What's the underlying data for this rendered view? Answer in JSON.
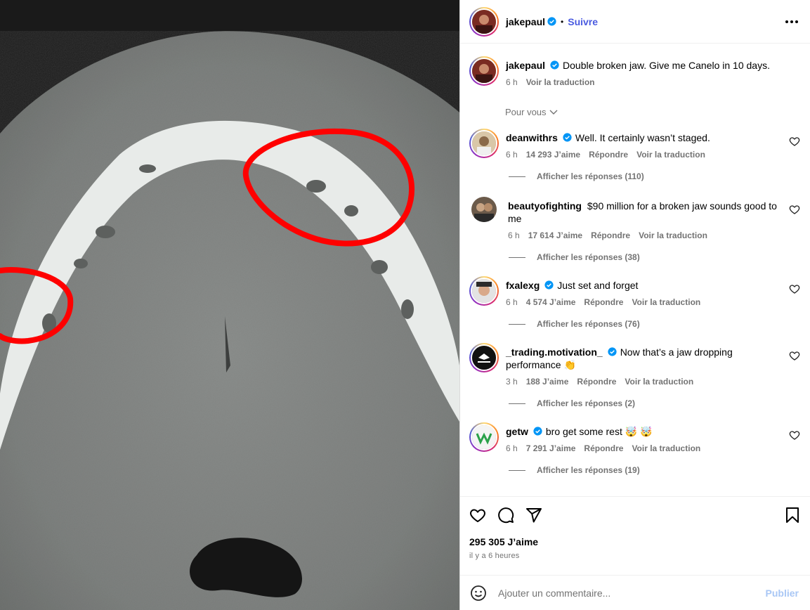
{
  "post": {
    "author": "jakepaul",
    "follow_label": "Suivre",
    "caption": "Double broken jaw. Give me Canelo in 10 days.",
    "caption_time": "6 h",
    "caption_translate": "Voir la traduction",
    "sort_label": "Pour vous"
  },
  "comments": [
    {
      "user": "deanwithrs",
      "verified": true,
      "text": "Well. It certainly wasn’t staged.",
      "time": "6 h",
      "likes": "14 293 J’aime",
      "reply": "Répondre",
      "translate": "Voir la traduction",
      "replies": "Afficher les réponses (110)"
    },
    {
      "user": "beautyofighting",
      "verified": false,
      "text": "$90 million for a broken jaw sounds good to me",
      "time": "6 h",
      "likes": "17 614 J’aime",
      "reply": "Répondre",
      "translate": "Voir la traduction",
      "replies": "Afficher les réponses (38)"
    },
    {
      "user": "fxalexg",
      "verified": true,
      "text": "Just set and forget",
      "time": "6 h",
      "likes": "4 574 J’aime",
      "reply": "Répondre",
      "translate": "Voir la traduction",
      "replies": "Afficher les réponses (76)"
    },
    {
      "user": "_trading.motivation_",
      "verified": true,
      "text": "Now that’s a jaw dropping performance 👏",
      "time": "3 h",
      "likes": "188 J’aime",
      "reply": "Répondre",
      "translate": "Voir la traduction",
      "replies": "Afficher les réponses (2)"
    },
    {
      "user": "getw",
      "verified": true,
      "text": "bro get some rest 🤯 🤯",
      "time": "6 h",
      "likes": "7 291 J’aime",
      "reply": "Répondre",
      "translate": "Voir la traduction",
      "replies": "Afficher les réponses (19)"
    }
  ],
  "footer": {
    "likes": "295 305 J’aime",
    "time": "il y a 6 heures",
    "comment_placeholder": "Ajouter un commentaire...",
    "publish_label": "Publier"
  },
  "colors": {
    "verified": "#0095f6",
    "follow": "#4a5be0",
    "annotation_red": "#ff0000"
  }
}
